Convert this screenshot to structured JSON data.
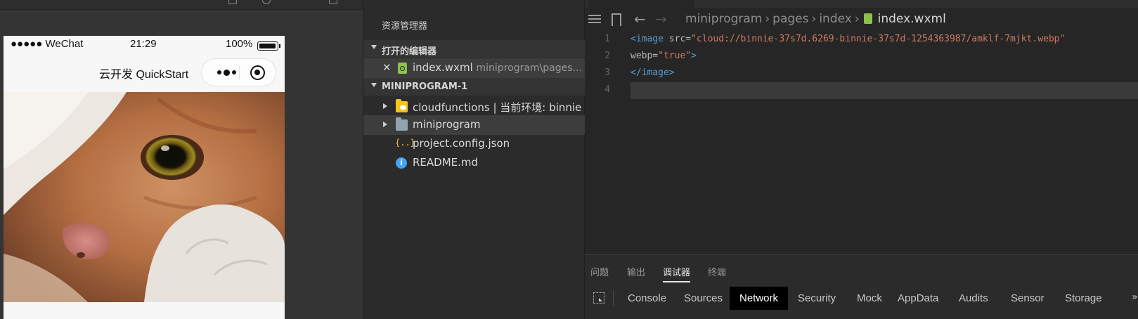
{
  "simulator": {
    "status_bar": {
      "carrier": "●●●●● WeChat",
      "time": "21:29",
      "battery": "100%"
    },
    "nav_title": "云开发 QuickStart",
    "capsule_icons": [
      "more-icon",
      "close-target-icon"
    ],
    "content_image": "cat-photo"
  },
  "explorer": {
    "title": "资源管理器",
    "open_editors": {
      "label": "打开的编辑器",
      "items": [
        {
          "name": "index.wxml",
          "path": "miniprogram\\pages..."
        }
      ]
    },
    "project": {
      "label": "MINIPROGRAM-1",
      "items": [
        {
          "name": "cloudfunctions | 当前环境: binnie",
          "icon": "cloud-folder-icon",
          "expandable": true
        },
        {
          "name": "miniprogram",
          "icon": "folder-icon",
          "expandable": true,
          "selected": true
        },
        {
          "name": "project.config.json",
          "icon": "json-icon",
          "expandable": false
        },
        {
          "name": "README.md",
          "icon": "info-icon",
          "expandable": false
        }
      ]
    }
  },
  "editor": {
    "breadcrumb": {
      "parts": [
        "miniprogram",
        "pages",
        "index"
      ],
      "file": "index.wxml"
    },
    "lines": [
      {
        "no": "1",
        "tokens": [
          [
            "tag",
            "<image"
          ],
          [
            "attr",
            " src="
          ],
          [
            "str",
            "\"cloud://binnie-37s7d.6269-binnie-37s7d-1254363987/amklf-7mjkt.webp\""
          ]
        ]
      },
      {
        "no": "2",
        "tokens": [
          [
            "attr",
            "webp="
          ],
          [
            "str",
            "\"true\""
          ],
          [
            "tag",
            ">"
          ]
        ]
      },
      {
        "no": "3",
        "tokens": [
          [
            "tag",
            "</image>"
          ]
        ]
      },
      {
        "no": "4",
        "tokens": []
      }
    ]
  },
  "debugger": {
    "panel_tabs": [
      "问题",
      "输出",
      "调试器",
      "终端"
    ],
    "active_panel_tab": "调试器",
    "devtools_tabs": [
      "Console",
      "Sources",
      "Network",
      "Security",
      "Mock",
      "AppData",
      "Audits",
      "Sensor",
      "Storage"
    ],
    "active_devtools_tab": "Network",
    "more": "»"
  },
  "colors": {
    "accent_active_tab": "#000000",
    "tag": "#569cd6",
    "string": "#ce7a60",
    "wxml_icon": "#8bc34a",
    "cloud_folder": "#f5c518",
    "info_icon": "#42a5f5"
  }
}
